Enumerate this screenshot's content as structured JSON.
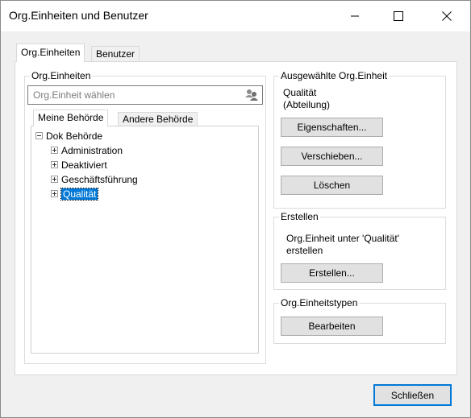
{
  "window": {
    "title": "Org.Einheiten und Benutzer"
  },
  "tabs": [
    {
      "label": "Org.Einheiten",
      "active": true
    },
    {
      "label": "Benutzer",
      "active": false
    }
  ],
  "orgunits_group": {
    "title": "Org.Einheiten",
    "search_placeholder": "Org.Einheit wählen",
    "subtabs": [
      {
        "label": "Meine Behörde",
        "active": true
      },
      {
        "label": "Andere Behörde",
        "active": false
      }
    ],
    "tree": {
      "root": "Dok Behörde",
      "children": [
        "Administration",
        "Deaktiviert",
        "Geschäftsführung",
        "Qualität"
      ],
      "selected": "Qualität"
    }
  },
  "selected_group": {
    "title": "Ausgewählte Org.Einheit",
    "name": "Qualität",
    "type": "(Abteilung)",
    "buttons": {
      "properties": "Eigenschaften...",
      "move": "Verschieben...",
      "delete": "Löschen"
    }
  },
  "create_group": {
    "title": "Erstellen",
    "text_line1": "Org.Einheit unter 'Qualität'",
    "text_line2": "erstellen",
    "button": "Erstellen..."
  },
  "types_group": {
    "title": "Org.Einheitstypen",
    "button": "Bearbeiten"
  },
  "footer": {
    "close_button": "Schließen"
  }
}
